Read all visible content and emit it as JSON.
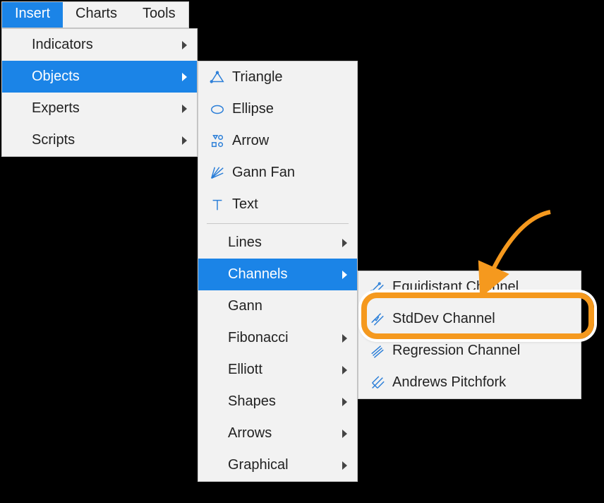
{
  "menubar": {
    "items": [
      {
        "label": "Insert",
        "active": true
      },
      {
        "label": "Charts",
        "active": false
      },
      {
        "label": "Tools",
        "active": false
      }
    ]
  },
  "insert_menu": {
    "items": [
      {
        "label": "Indicators",
        "active": false
      },
      {
        "label": "Objects",
        "active": true
      },
      {
        "label": "Experts",
        "active": false
      },
      {
        "label": "Scripts",
        "active": false
      }
    ]
  },
  "objects_menu": {
    "section_a": [
      {
        "label": "Triangle",
        "icon": "triangle-icon"
      },
      {
        "label": "Ellipse",
        "icon": "ellipse-icon"
      },
      {
        "label": "Arrow",
        "icon": "arrow-icon"
      },
      {
        "label": "Gann Fan",
        "icon": "gannfan-icon"
      },
      {
        "label": "Text",
        "icon": "text-icon"
      }
    ],
    "section_b": [
      {
        "label": "Lines",
        "active": false
      },
      {
        "label": "Channels",
        "active": true
      },
      {
        "label": "Gann",
        "active": false,
        "has_arrow": false
      },
      {
        "label": "Fibonacci",
        "active": false
      },
      {
        "label": "Elliott",
        "active": false
      },
      {
        "label": "Shapes",
        "active": false
      },
      {
        "label": "Arrows",
        "active": false
      },
      {
        "label": "Graphical",
        "active": false
      }
    ]
  },
  "channels_menu": {
    "items": [
      {
        "label": "Equidistant Channel",
        "icon": "equi-channel-icon"
      },
      {
        "label": "StdDev Channel",
        "icon": "stddev-channel-icon"
      },
      {
        "label": "Regression Channel",
        "icon": "regression-channel-icon"
      },
      {
        "label": "Andrews Pitchfork",
        "icon": "pitchfork-icon"
      }
    ]
  },
  "highlight_target": "StdDev Channel"
}
